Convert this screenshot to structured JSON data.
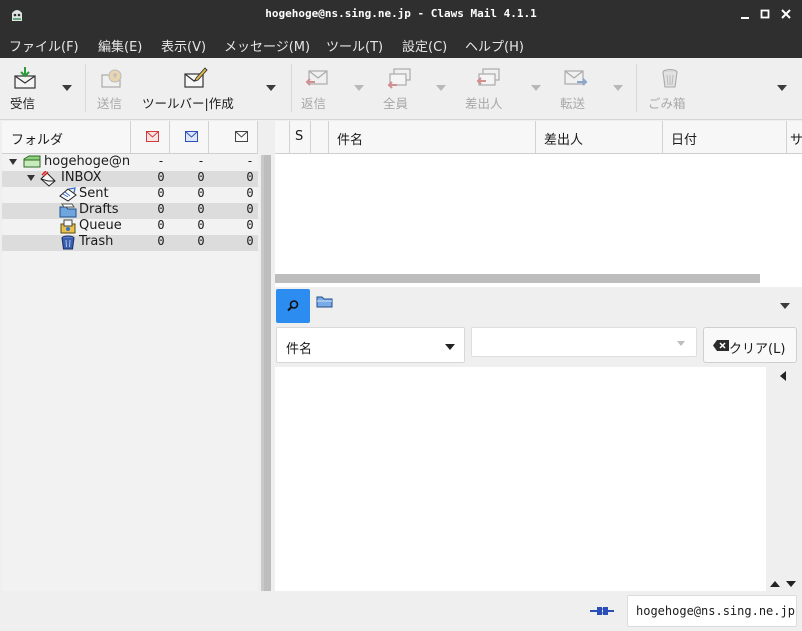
{
  "window": {
    "title": "hogehoge@ns.sing.ne.jp - Claws Mail 4.1.1",
    "controls": [
      "minimize-icon",
      "maximize-icon",
      "close-icon"
    ]
  },
  "menubar": {
    "items": [
      "ファイル(F)",
      "編集(E)",
      "表示(V)",
      "メッセージ(M)",
      "ツール(T)",
      "設定(C)",
      "ヘルプ(H)"
    ]
  },
  "toolbar": {
    "buttons": [
      {
        "label": "受信",
        "icon": "receive-mail-icon",
        "enabled": true,
        "has_menu": true
      },
      {
        "label": "送信",
        "icon": "send-mail-icon",
        "enabled": false
      },
      {
        "label": "ツールバー|作成",
        "icon": "compose-icon",
        "enabled": true,
        "has_menu": true
      },
      {
        "label": "返信",
        "icon": "reply-icon",
        "enabled": false,
        "has_menu": true
      },
      {
        "label": "全員",
        "icon": "reply-all-icon",
        "enabled": false,
        "has_menu": true
      },
      {
        "label": "差出人",
        "icon": "reply-to-sender-icon",
        "enabled": false,
        "has_menu": true
      },
      {
        "label": "転送",
        "icon": "forward-icon",
        "enabled": false,
        "has_menu": true
      },
      {
        "label": "ごみ箱",
        "icon": "trash-icon",
        "enabled": false
      }
    ]
  },
  "folder_pane": {
    "header": {
      "folder": "フォルダ",
      "columns": [
        "new-mail-icon",
        "unread-mail-icon",
        "total-mail-icon"
      ]
    },
    "rows": [
      {
        "name": "hogehoge@ns.sing.ne.jp",
        "new": "-",
        "unread": "-",
        "total": "-",
        "icon": "mailbox-icon",
        "expanded": true
      },
      {
        "name": "INBOX",
        "new": "0",
        "unread": "0",
        "total": "0",
        "icon": "inbox-icon",
        "expanded": true
      },
      {
        "name": "Sent",
        "new": "0",
        "unread": "0",
        "total": "0",
        "icon": "sent-folder-icon"
      },
      {
        "name": "Drafts",
        "new": "0",
        "unread": "0",
        "total": "0",
        "icon": "drafts-folder-icon"
      },
      {
        "name": "Queue",
        "new": "0",
        "unread": "0",
        "total": "0",
        "icon": "queue-folder-icon"
      },
      {
        "name": "Trash",
        "new": "0",
        "unread": "0",
        "total": "0",
        "icon": "trash-folder-icon"
      }
    ]
  },
  "message_list": {
    "columns": [
      "S",
      "",
      "件名",
      "差出人",
      "日付",
      "サ"
    ]
  },
  "quick_search": {
    "search_button_icon": "search-icon",
    "folder_button_icon": "folder-icon",
    "search_type": "件名",
    "search_value": "",
    "clear_label": "クリア(L)"
  },
  "status": {
    "account": "hogehoge@ns.sing.ne.jp",
    "connection_icon": "online-plug-icon"
  },
  "colors": {
    "titlebar_bg": "#2f2f2f",
    "accent": "#2d8cf0",
    "disabled_text": "#a8a8a8"
  }
}
